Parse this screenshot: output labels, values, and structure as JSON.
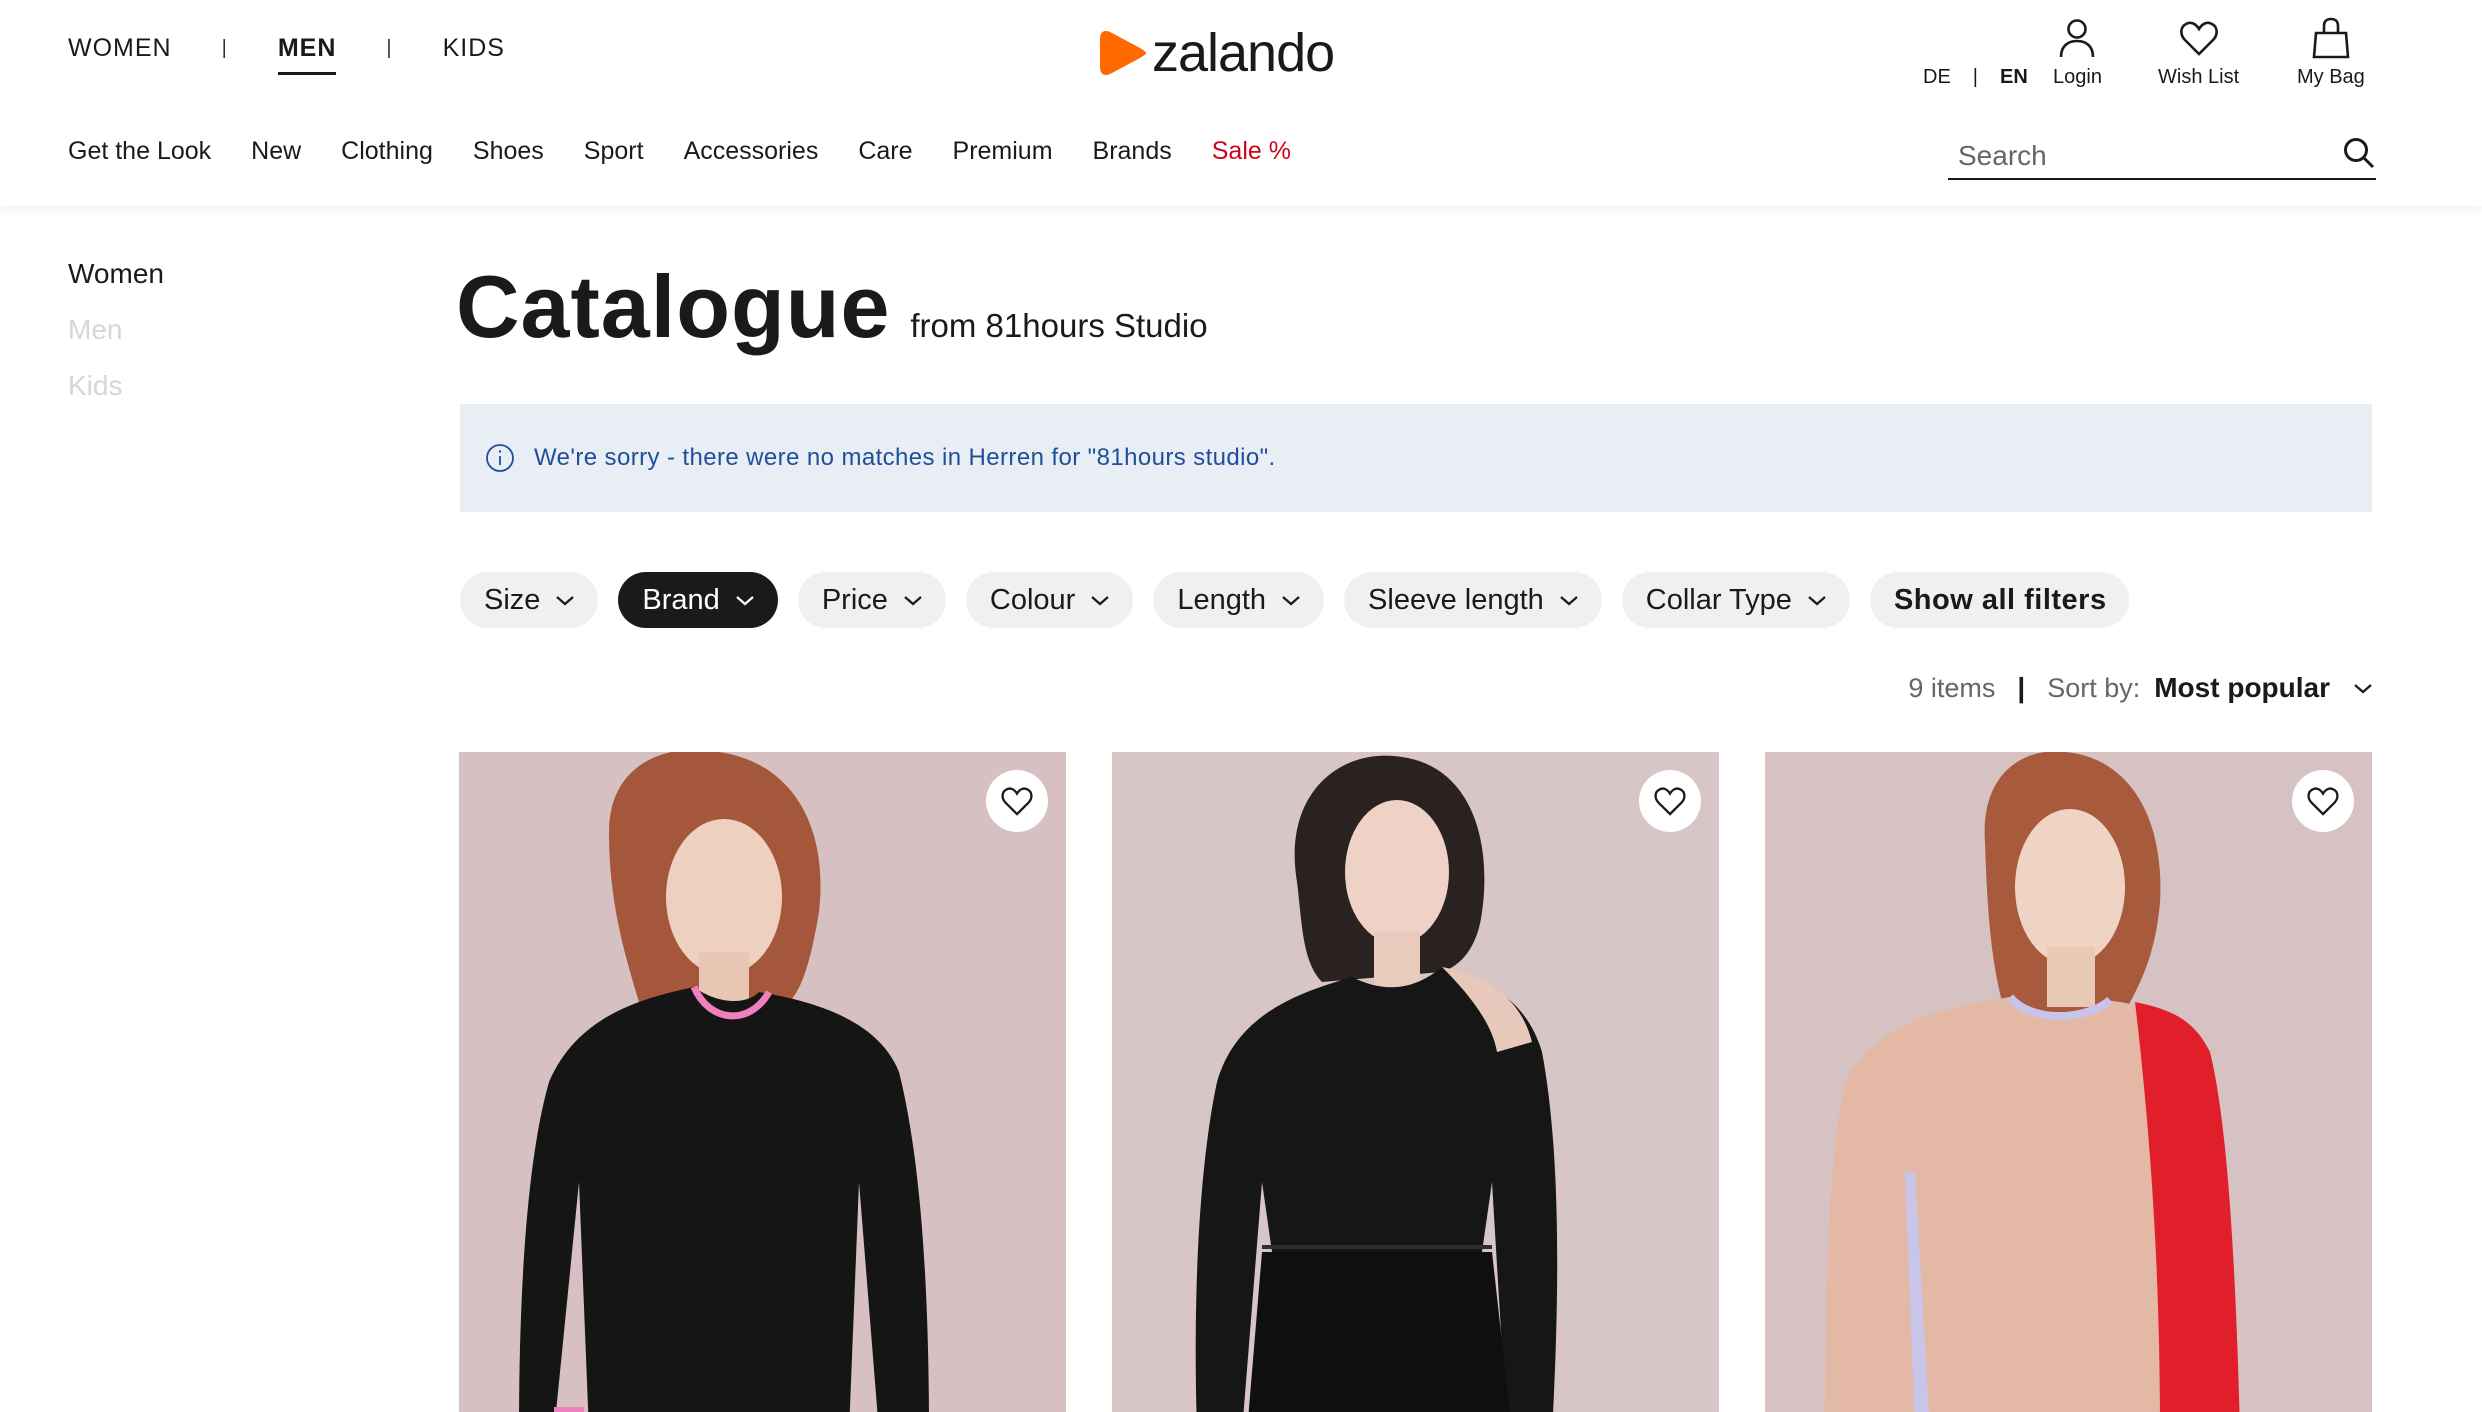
{
  "header": {
    "departments": [
      {
        "label": "WOMEN",
        "active": false
      },
      {
        "label": "MEN",
        "active": true
      },
      {
        "label": "KIDS",
        "active": false
      }
    ],
    "dept_separator": "|",
    "logo_text": "zalando",
    "logo_color": "#ff6900",
    "lang": {
      "de": "DE",
      "separator": "|",
      "en": "EN"
    },
    "actions": [
      {
        "label": "Login",
        "icon": "user-icon"
      },
      {
        "label": "Wish List",
        "icon": "heart-icon"
      },
      {
        "label": "My Bag",
        "icon": "bag-icon"
      }
    ],
    "nav": [
      "Get the Look",
      "New",
      "Clothing",
      "Shoes",
      "Sport",
      "Accessories",
      "Care",
      "Premium",
      "Brands",
      "Sale %"
    ],
    "sale_color": "#d0021b",
    "search_placeholder": "Search"
  },
  "sidebar": {
    "items": [
      {
        "label": "Women",
        "muted": false
      },
      {
        "label": "Men",
        "muted": true
      },
      {
        "label": "Kids",
        "muted": true
      }
    ]
  },
  "main": {
    "title": "Catalogue",
    "subtitle": "from 81hours Studio",
    "notice": "We're sorry - there were no matches in Herren for \"81hours studio\".",
    "notice_color": "#1f4f9a",
    "filters": [
      {
        "label": "Size",
        "selected": false
      },
      {
        "label": "Brand",
        "selected": true
      },
      {
        "label": "Price",
        "selected": false
      },
      {
        "label": "Colour",
        "selected": false
      },
      {
        "label": "Length",
        "selected": false
      },
      {
        "label": "Sleeve length",
        "selected": false
      },
      {
        "label": "Collar Type",
        "selected": false
      }
    ],
    "show_all_filters": "Show all filters",
    "item_count": "9 items",
    "sort_separator": "|",
    "sort_label": "Sort by:",
    "sort_value": "Most popular"
  },
  "products": [
    {
      "image": "black knit jumper with pink trim",
      "favorite_icon": "heart-outline-icon"
    },
    {
      "image": "black sheer one-shoulder knit top",
      "favorite_icon": "heart-outline-icon"
    },
    {
      "image": "beige, red and lilac colour-block jumper",
      "favorite_icon": "heart-outline-icon"
    }
  ]
}
